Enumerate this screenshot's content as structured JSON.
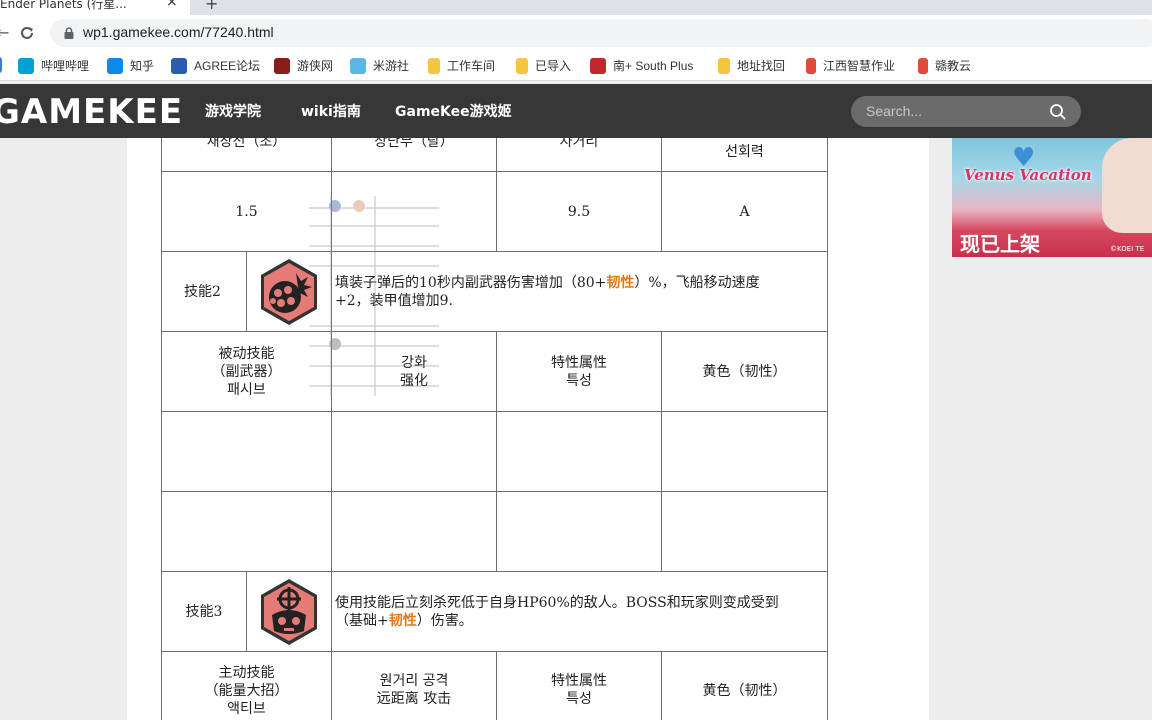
{
  "browser": {
    "tab_title": "Ender Planets (行星...",
    "tab_close": "×",
    "new_tab": "+",
    "url": "wp1.gamekee.com/77240.html",
    "back_glyph": "←"
  },
  "bookmarks": [
    {
      "label": "",
      "icon": "bookmark-icon",
      "color": "#3a7bd5"
    },
    {
      "label": "哔哩哔哩",
      "icon": "bilibili-icon",
      "color": "#00a1d6"
    },
    {
      "label": "知乎",
      "icon": "zhihu-icon",
      "color": "#0f88eb"
    },
    {
      "label": "AGREE论坛",
      "icon": "agree-icon",
      "color": "#2a5db0"
    },
    {
      "label": "游侠网",
      "icon": "youxia-icon",
      "color": "#8a1c1c"
    },
    {
      "label": "米游社",
      "icon": "miyoushe-icon",
      "color": "#5bb8e6"
    },
    {
      "label": "工作车间",
      "icon": "folder-icon",
      "color": "#f5c542"
    },
    {
      "label": "已导入",
      "icon": "folder-icon",
      "color": "#f5c542"
    },
    {
      "label": "南+ South Plus",
      "icon": "southplus-icon",
      "color": "#c0282d"
    },
    {
      "label": "地址找回",
      "icon": "folder-icon",
      "color": "#f5c542"
    },
    {
      "label": "江西智慧作业",
      "icon": "jiangxi-icon",
      "color": "#e04a3a"
    },
    {
      "label": "赣教云",
      "icon": "ganjiaoyun-icon",
      "color": "#e04a3a"
    }
  ],
  "site": {
    "logo": "GAMEKEE",
    "nav": [
      "游戏学院",
      "wiki指南",
      "GameKee游戏姬"
    ],
    "search_placeholder": "Search..."
  },
  "ad": {
    "brand": "Venus Vacation",
    "cta": "现已上架",
    "copyright": "©KOEI TE"
  },
  "table": {
    "row_top": [
      "재장전（초）",
      "상단부（탈）",
      "사거리",
      "선회력"
    ],
    "row_values": [
      "1.5",
      "",
      "9.5",
      "A"
    ],
    "skill2": {
      "label": "技能2",
      "desc_a": "填装子弹后的10秒内副武器伤害增加（80+",
      "desc_hl": "韧性",
      "desc_b": "）%，飞船移动速度",
      "desc_c": "+2，装甲值增加9."
    },
    "passive": {
      "type_cn": "被动技能",
      "type_sub": "（副武器）",
      "type_kr": "패시브",
      "effect_kr": "강화",
      "effect_cn": "强化",
      "attr_cn": "特性属性",
      "attr_kr": "특성",
      "color": "黄色（韧性）"
    },
    "skill3": {
      "label": "技能3",
      "desc_a": "使用技能后立刻杀死低于自身HP60%的敌人。BOSS和玩家则变成受到",
      "desc_b": "（基础+",
      "desc_hl": "韧性",
      "desc_c": "）伤害。"
    },
    "active": {
      "type_cn": "主动技能",
      "type_sub": "（能量大招）",
      "type_kr": "액티브",
      "range_kr": "원거리 공격",
      "range_cn": "远距离 攻击",
      "attr_cn": "特性属性",
      "attr_kr": "특성",
      "color": "黄色（韧性）"
    }
  }
}
